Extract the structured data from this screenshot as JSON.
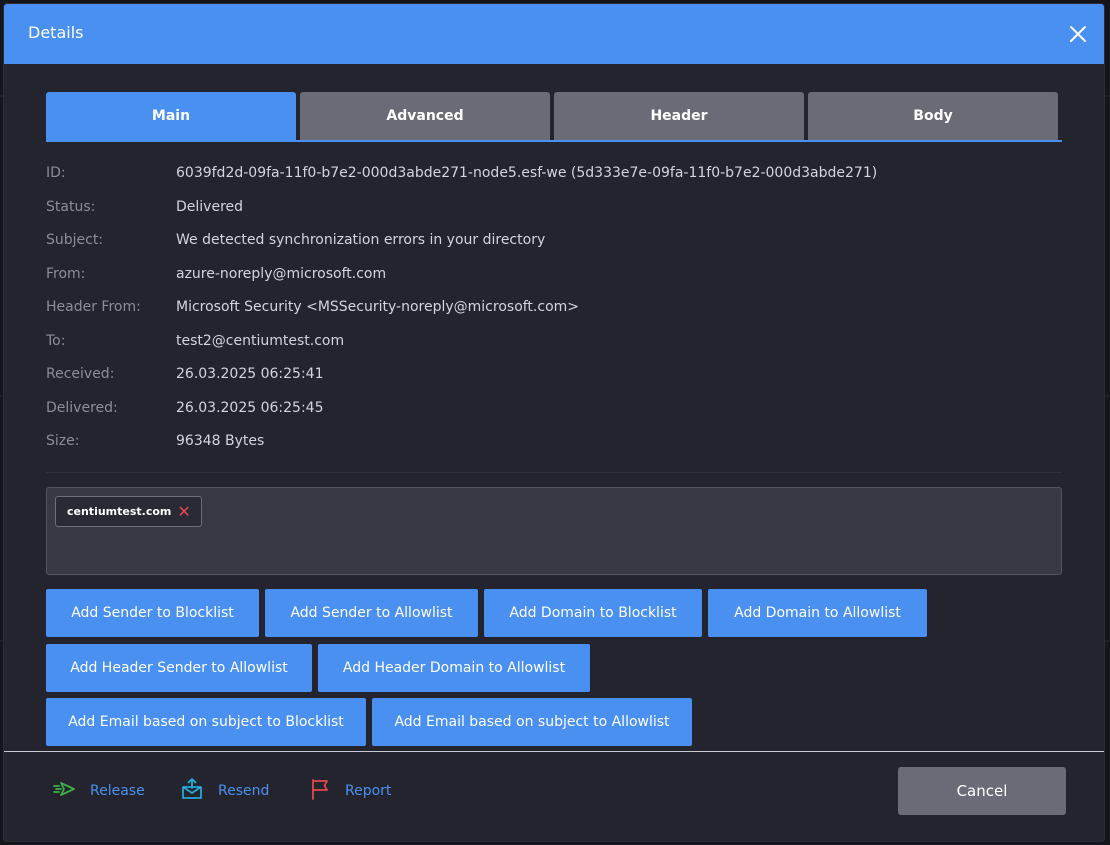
{
  "dialog": {
    "title": "Details"
  },
  "tabs": [
    {
      "label": "Main",
      "active": true
    },
    {
      "label": "Advanced",
      "active": false
    },
    {
      "label": "Header",
      "active": false
    },
    {
      "label": "Body",
      "active": false
    }
  ],
  "details": [
    {
      "label": "ID:",
      "value": "6039fd2d-09fa-11f0-b7e2-000d3abde271-node5.esf-we (5d333e7e-09fa-11f0-b7e2-000d3abde271)"
    },
    {
      "label": "Status:",
      "value": "Delivered"
    },
    {
      "label": "Subject:",
      "value": "We detected synchronization errors in your directory"
    },
    {
      "label": "From:",
      "value": "azure-noreply@microsoft.com"
    },
    {
      "label": "Header From:",
      "value": "Microsoft Security <MSSecurity-noreply@microsoft.com>"
    },
    {
      "label": "To:",
      "value": "test2@centiumtest.com"
    },
    {
      "label": "Received:",
      "value": "26.03.2025 06:25:41"
    },
    {
      "label": "Delivered:",
      "value": "26.03.2025 06:25:45"
    },
    {
      "label": "Size:",
      "value": "96348 Bytes"
    }
  ],
  "tags": [
    {
      "label": "centiumtest.com",
      "remove_symbol": "✕"
    }
  ],
  "actions": [
    "Add Sender to Blocklist",
    "Add Sender to Allowlist",
    "Add Domain to Blocklist",
    "Add Domain to Allowlist",
    "Add Header Sender to Allowlist",
    "Add Header Domain to Allowlist",
    "Add Email based on subject to Blocklist",
    "Add Email based on subject to Allowlist"
  ],
  "footer": {
    "release": {
      "label": "Release",
      "icon": "release-arrow-icon",
      "color": "#3fae49"
    },
    "resend": {
      "label": "Resend",
      "icon": "resend-envelope-icon",
      "color": "#2aa7d8"
    },
    "report": {
      "label": "Report",
      "icon": "flag-icon",
      "color": "#e5484d"
    },
    "cancel_label": "Cancel"
  },
  "colors": {
    "accent": "#4a90f0",
    "tab_inactive": "#6b6b78",
    "panel": "#23242e",
    "danger": "#e5484d"
  }
}
